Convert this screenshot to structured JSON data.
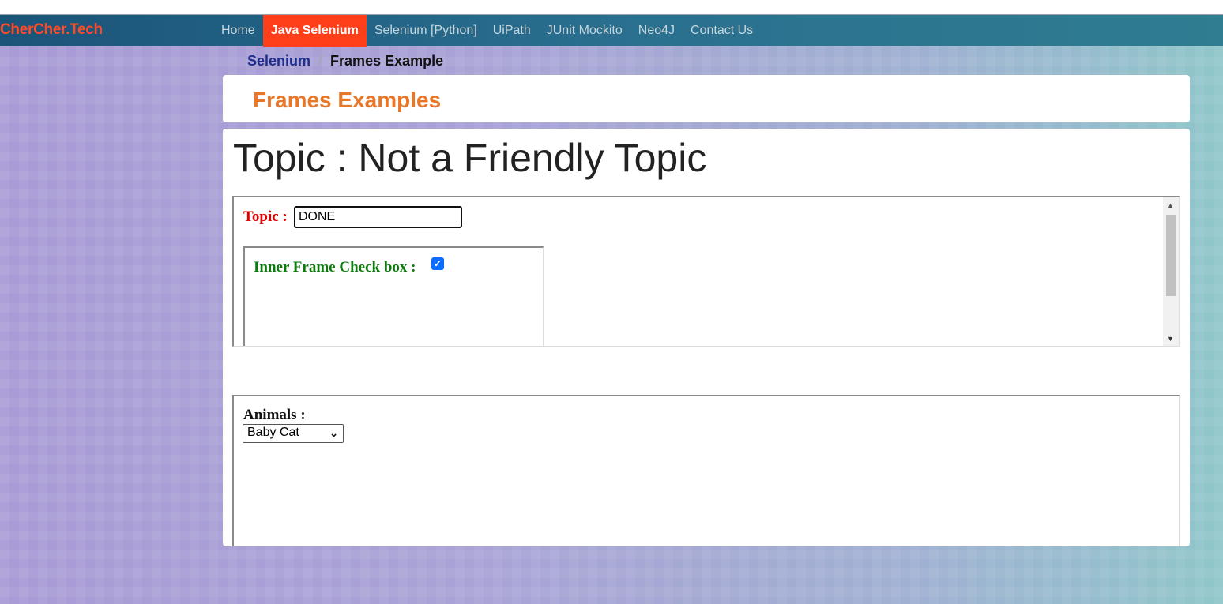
{
  "brand": "CherCher.Tech",
  "nav": {
    "items": [
      {
        "label": "Home",
        "active": false
      },
      {
        "label": "Java Selenium",
        "active": true
      },
      {
        "label": "Selenium [Python]",
        "active": false
      },
      {
        "label": "UiPath",
        "active": false
      },
      {
        "label": "JUnit Mockito",
        "active": false
      },
      {
        "label": "Neo4J",
        "active": false
      },
      {
        "label": "Contact Us",
        "active": false
      }
    ]
  },
  "breadcrumb": {
    "parent": "Selenium",
    "separator": "/",
    "current": "Frames Example"
  },
  "page": {
    "title": "Frames Examples",
    "topic_heading": "Topic : Not a Friendly Topic"
  },
  "frame1": {
    "topic_label": "Topic :",
    "topic_value": "DONE",
    "inner_frame": {
      "checkbox_label": "Inner Frame Check box :",
      "checkbox_checked": true
    }
  },
  "frame2": {
    "animals_label": "Animals :",
    "selected_animal": "Baby Cat"
  },
  "colors": {
    "navbar": "#1b5479",
    "nav_active": "#ff3f1a",
    "brand": "#ff4a2a",
    "page_title": "#e8772a",
    "topic_label": "#e00000",
    "inner_label": "#0d7a0d"
  }
}
